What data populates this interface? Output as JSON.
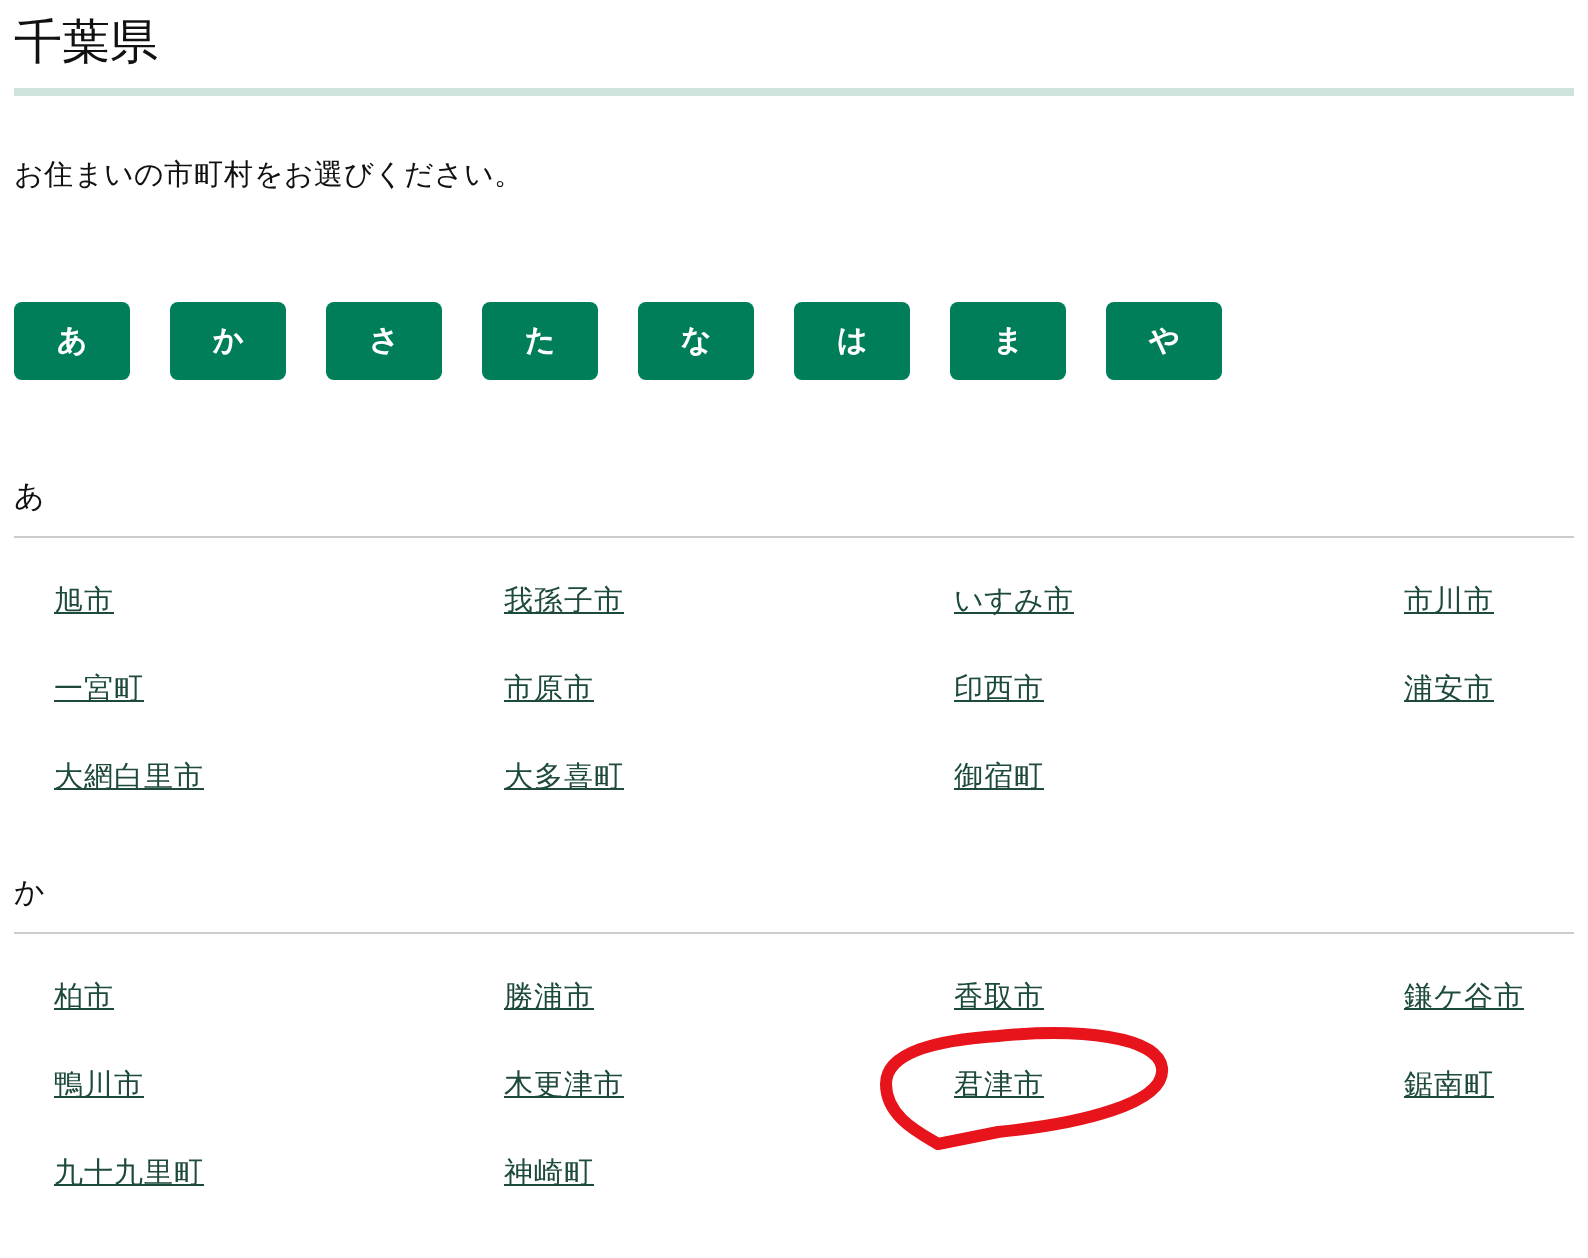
{
  "title": "千葉県",
  "intro": "お住まいの市町村をお選びください。",
  "index_buttons": [
    "あ",
    "か",
    "さ",
    "た",
    "な",
    "は",
    "ま",
    "や"
  ],
  "sections": [
    {
      "heading": "あ",
      "items": [
        {
          "label": "旭市",
          "circled": false
        },
        {
          "label": "我孫子市",
          "circled": false
        },
        {
          "label": "いすみ市",
          "circled": false
        },
        {
          "label": "市川市",
          "circled": false
        },
        {
          "label": "一宮町",
          "circled": false
        },
        {
          "label": "市原市",
          "circled": false
        },
        {
          "label": "印西市",
          "circled": false
        },
        {
          "label": "浦安市",
          "circled": false
        },
        {
          "label": "大網白里市",
          "circled": false
        },
        {
          "label": "大多喜町",
          "circled": false
        },
        {
          "label": "御宿町",
          "circled": false
        }
      ]
    },
    {
      "heading": "か",
      "items": [
        {
          "label": "柏市",
          "circled": false
        },
        {
          "label": "勝浦市",
          "circled": false
        },
        {
          "label": "香取市",
          "circled": false
        },
        {
          "label": "鎌ケ谷市",
          "circled": false
        },
        {
          "label": "鴨川市",
          "circled": false
        },
        {
          "label": "木更津市",
          "circled": false
        },
        {
          "label": "君津市",
          "circled": true
        },
        {
          "label": "鋸南町",
          "circled": false
        },
        {
          "label": "九十九里町",
          "circled": false
        },
        {
          "label": "神崎町",
          "circled": false
        }
      ]
    }
  ]
}
